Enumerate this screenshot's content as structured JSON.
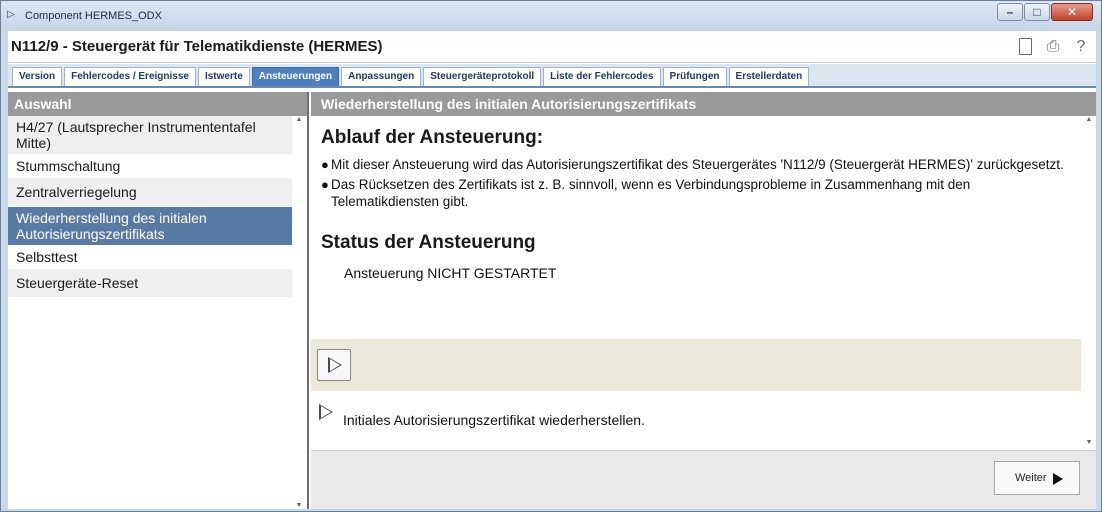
{
  "window": {
    "title": "Component HERMES_ODX"
  },
  "header": {
    "title": "N112/9 - Steuergerät für Telematikdienste (HERMES)",
    "help_glyph": "?"
  },
  "tabs": [
    {
      "label": "Version"
    },
    {
      "label": "Fehlercodes / Ereignisse"
    },
    {
      "label": "Istwerte"
    },
    {
      "label": "Ansteuerungen",
      "active": true
    },
    {
      "label": "Anpassungen"
    },
    {
      "label": "Steuergeräteprotokoll"
    },
    {
      "label": "Liste der Fehlercodes"
    },
    {
      "label": "Prüfungen"
    },
    {
      "label": "Erstellerdaten"
    }
  ],
  "left_panel": {
    "heading": "Auswahl",
    "items": [
      {
        "label": "H4/27 (Lautsprecher Instrumententafel Mitte)"
      },
      {
        "label": "Stummschaltung"
      },
      {
        "label": "Zentralverriegelung"
      },
      {
        "label": "Wiederherstellung des initialen Autorisierungszertifikats",
        "selected": true
      },
      {
        "label": "Selbsttest"
      },
      {
        "label": "Steuergeräte-Reset"
      }
    ]
  },
  "right_panel": {
    "heading": "Wiederherstellung des initialen Autorisierungszertifikats",
    "procedure_heading": "Ablauf der Ansteuerung:",
    "bullets": [
      "Mit dieser Ansteuerung wird das Autorisierungszertifikat des Steuergerätes 'N112/9 (Steuergerät HERMES)' zurückgesetzt.",
      "Das Rücksetzen des Zertifikats ist z. B. sinnvoll, wenn es Verbindungsprobleme in Zusammenhang mit den Telematikdiensten gibt."
    ],
    "status_heading": "Status der Ansteuerung",
    "status_text": "Ansteuerung NICHT GESTARTET",
    "action_label": "Initiales Autorisierungszertifikat wiederherstellen.",
    "next_label": "Weiter"
  },
  "colors": {
    "active_tab": "#4d7fc1",
    "selected_item": "#5a7aa6",
    "panel_header": "#9a9a9a",
    "action_band": "#ebe8da"
  }
}
